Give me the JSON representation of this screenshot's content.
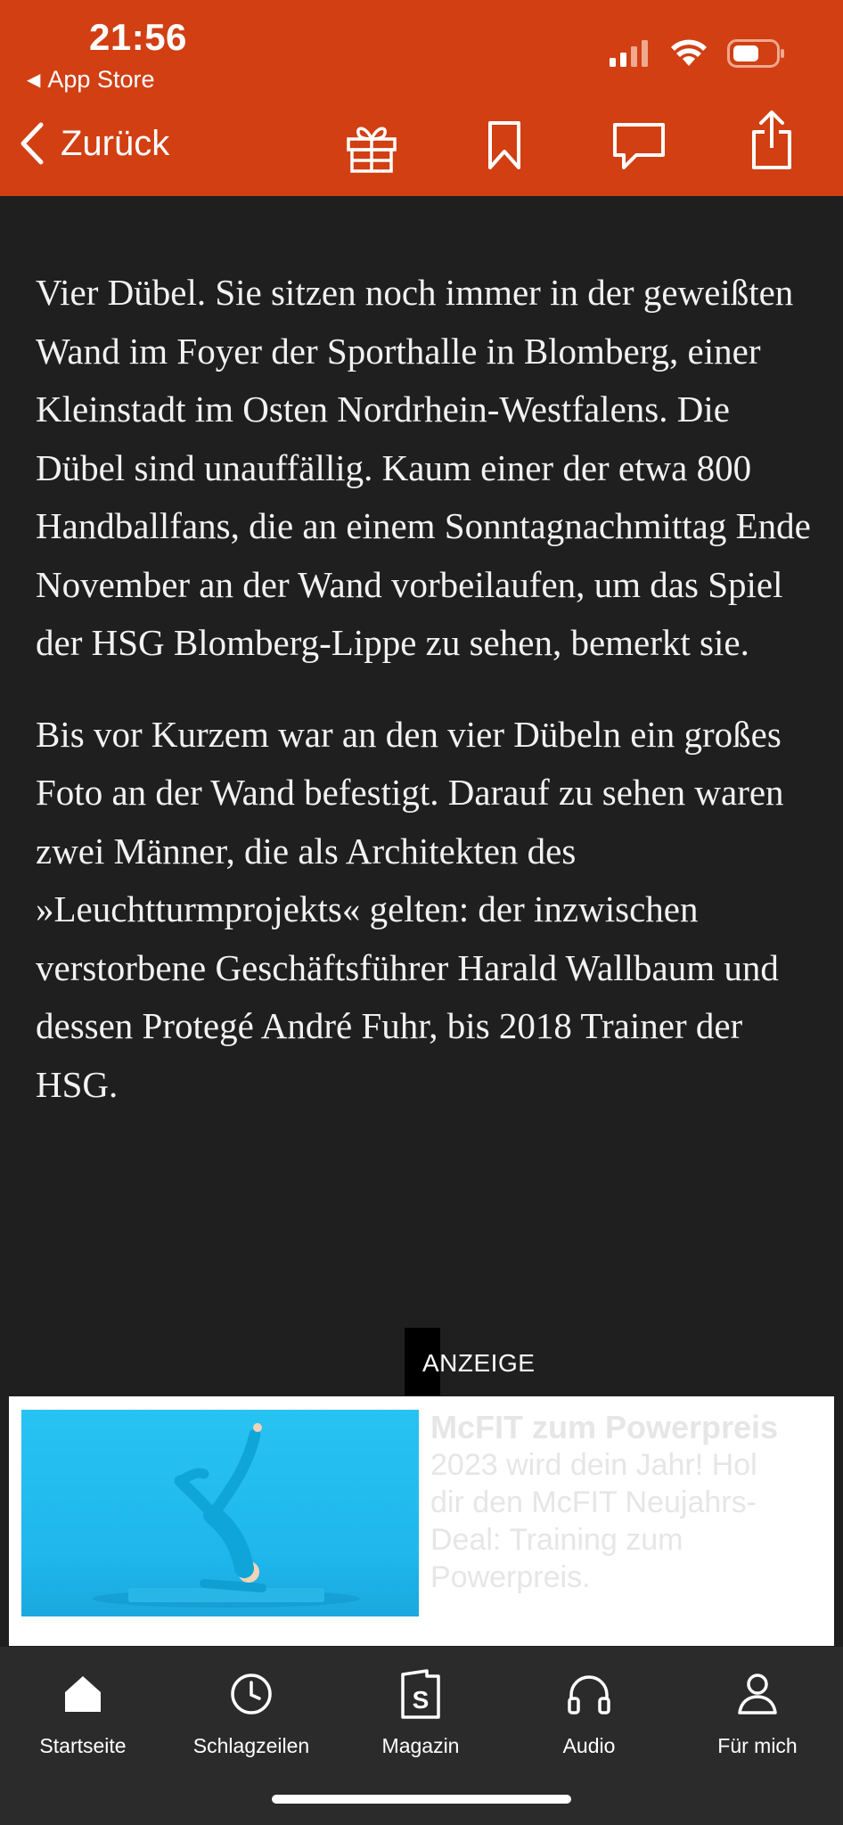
{
  "status_bar": {
    "time": "21:56",
    "back_app": "App Store"
  },
  "nav": {
    "back_label": "Zurück",
    "icons": [
      "gift-icon",
      "bookmark-icon",
      "comment-icon",
      "share-icon"
    ]
  },
  "article": {
    "paragraphs": [
      "Vier Dübel. Sie sitzen noch immer in der geweißten Wand im Foyer der Sporthalle in Blomberg, einer Kleinstadt im Osten Nordrhein-Westfalens. Die Dübel sind unauffällig. Kaum einer der etwa 800 Handballfans, die an einem Sonntagnachmittag Ende November an der Wand vorbeilaufen, um das Spiel der HSG Blomberg-Lippe zu sehen, bemerkt sie.",
      "Bis vor Kurzem war an den vier Dübeln ein großes Foto an der Wand befestigt. Darauf zu sehen waren zwei Männer, die als Architekten des »Leuchtturmprojekts« gelten: der inzwischen verstorbene Geschäftsführer Harald Wallbaum und dessen Protegé André Fuhr, bis 2018 Trainer der HSG."
    ]
  },
  "ad": {
    "label": "ANZEIGE",
    "title": "McFIT zum Powerpreis",
    "description": "2023 wird dein Jahr! Hol dir den McFIT Neujahrs-Deal: Training zum Powerpreis."
  },
  "tabbar": {
    "tabs": [
      {
        "label": "Startseite",
        "icon": "home-icon"
      },
      {
        "label": "Schlagzeilen",
        "icon": "clock-icon"
      },
      {
        "label": "Magazin",
        "icon": "magazine-icon"
      },
      {
        "label": "Audio",
        "icon": "headphones-icon"
      },
      {
        "label": "Für mich",
        "icon": "person-icon"
      }
    ]
  },
  "colors": {
    "brand": "#d13f13",
    "background": "#1f1f1f",
    "tabbar": "#2b2b2b"
  }
}
